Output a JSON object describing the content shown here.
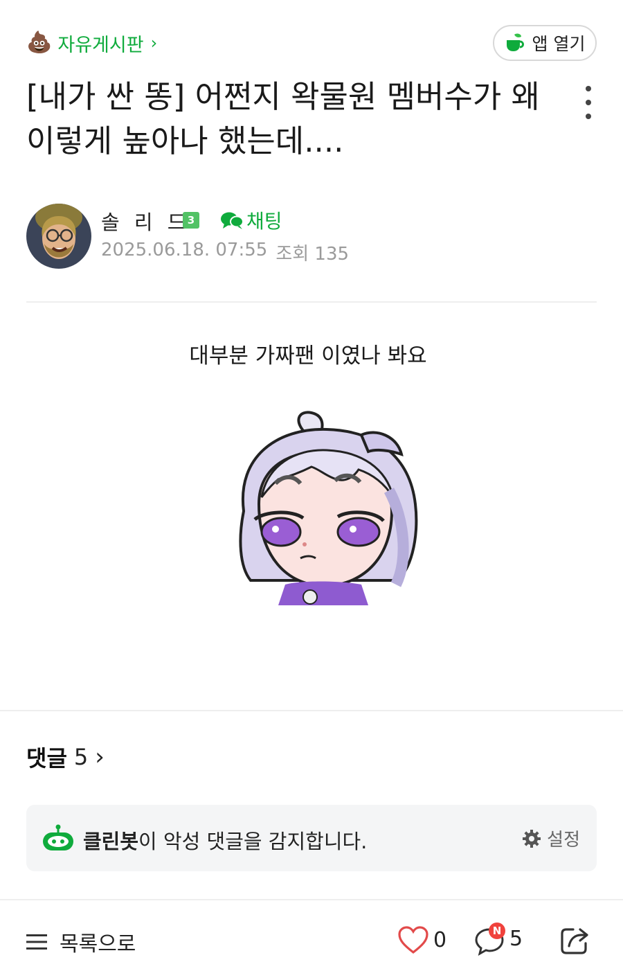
{
  "header": {
    "board_icon": "poop-icon",
    "board_name": "자유게시판",
    "app_open_label": "앱 열기",
    "app_icon": "cafe-cup-icon"
  },
  "post": {
    "title": "[내가 싼 똥] 어쩐지 왁물원 멤버수가 왜 이렇게 높아나 했는데....",
    "author": "솔 리 드",
    "level": "3",
    "chat_label": "채팅",
    "date": "2025.06.18. 07:55",
    "views_label": "조회 135",
    "body_text": "대부분 가짜팬 이였나 봐요"
  },
  "comments": {
    "label": "댓글",
    "count": "5"
  },
  "cleanbot": {
    "name": "클린봇",
    "message": "이 악성 댓글을 감지합니다.",
    "settings_label": "설정"
  },
  "bottom_bar": {
    "list_label": "목록으로",
    "like_count": "0",
    "comment_count": "5",
    "new_badge": "N"
  },
  "colors": {
    "accent": "#0fab3c",
    "like_red": "#e24a4a",
    "badge_red": "#f0423c"
  }
}
